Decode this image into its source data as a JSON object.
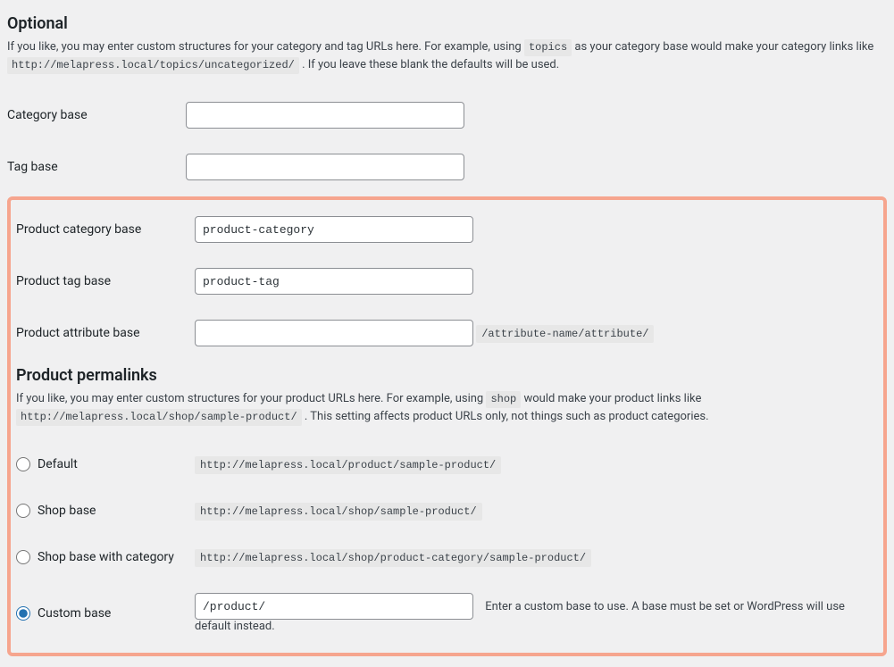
{
  "optional": {
    "heading": "Optional",
    "desc_prefix": "If you like, you may enter custom structures for your category and tag URLs here. For example, using ",
    "desc_code1": "topics",
    "desc_mid": " as your category base would make your category links like ",
    "desc_code2": "http://melapress.local/topics/uncategorized/",
    "desc_suffix": " . If you leave these blank the defaults will be used.",
    "category_base_label": "Category base",
    "category_base_value": "",
    "tag_base_label": "Tag base",
    "tag_base_value": ""
  },
  "product_bases": {
    "category_label": "Product category base",
    "category_value": "product-category",
    "tag_label": "Product tag base",
    "tag_value": "product-tag",
    "attr_label": "Product attribute base",
    "attr_value": "",
    "attr_hint": "/attribute-name/attribute/"
  },
  "permalinks": {
    "heading": "Product permalinks",
    "desc_prefix": "If you like, you may enter custom structures for your product URLs here. For example, using ",
    "desc_code1": "shop",
    "desc_mid": " would make your product links like ",
    "desc_code2": "http://melapress.local/shop/sample-product/",
    "desc_suffix": " . This setting affects product URLs only, not things such as product categories.",
    "options": {
      "default": {
        "label": "Default",
        "example": "http://melapress.local/product/sample-product/"
      },
      "shop": {
        "label": "Shop base",
        "example": "http://melapress.local/shop/sample-product/"
      },
      "shopcat": {
        "label": "Shop base with category",
        "example": "http://melapress.local/shop/product-category/sample-product/"
      },
      "custom": {
        "label": "Custom base",
        "value": "/product/",
        "hint": "Enter a custom base to use. A base must be set or WordPress will use default instead."
      }
    }
  }
}
